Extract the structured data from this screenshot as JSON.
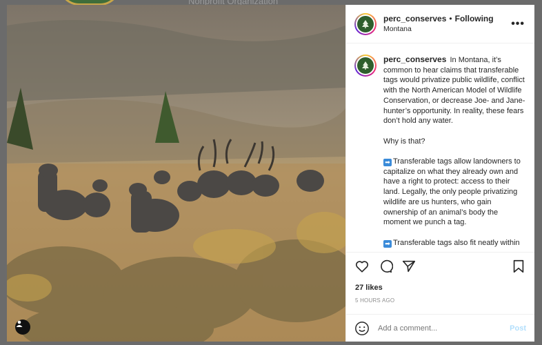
{
  "background": {
    "org_text": "Nonprofit Organization"
  },
  "post": {
    "username": "perc_conserves",
    "follow_label": "Following",
    "location": "Montana",
    "caption_paragraphs": [
      "In Montana, it’s common to hear claims that transferable tags would privatize public wildlife, conflict with the North American Model of Wildlife Conservation, or decrease Joe- and Jane-hunter’s opportunity. In reality, these fears don’t hold any water.",
      "Why is that?",
      "Transferable tags allow landowners to capitalize on what they already own and have a right to protect: access to their land. Legally, the only people privatizing wildlife are us hunters, who gain ownership of an animal’s body the moment we punch a tag.",
      "Transferable tags also fit neatly within"
    ],
    "likes": "27 likes",
    "time_ago": "5 HOURS AGO",
    "comment_placeholder": "Add a comment...",
    "post_label": "Post"
  },
  "icons": {
    "more": "more-options-icon",
    "like": "heart-icon",
    "comment": "comment-icon",
    "share": "paper-plane-icon",
    "save": "bookmark-icon",
    "emoji": "smiley-icon",
    "tag": "user-tag-icon",
    "bullet": "right-arrow-emoji"
  },
  "colors": {
    "brand_green": "#2f5f2d",
    "post_disabled": "#b2dffc",
    "text": "#262626",
    "muted": "#8e8e8e"
  }
}
